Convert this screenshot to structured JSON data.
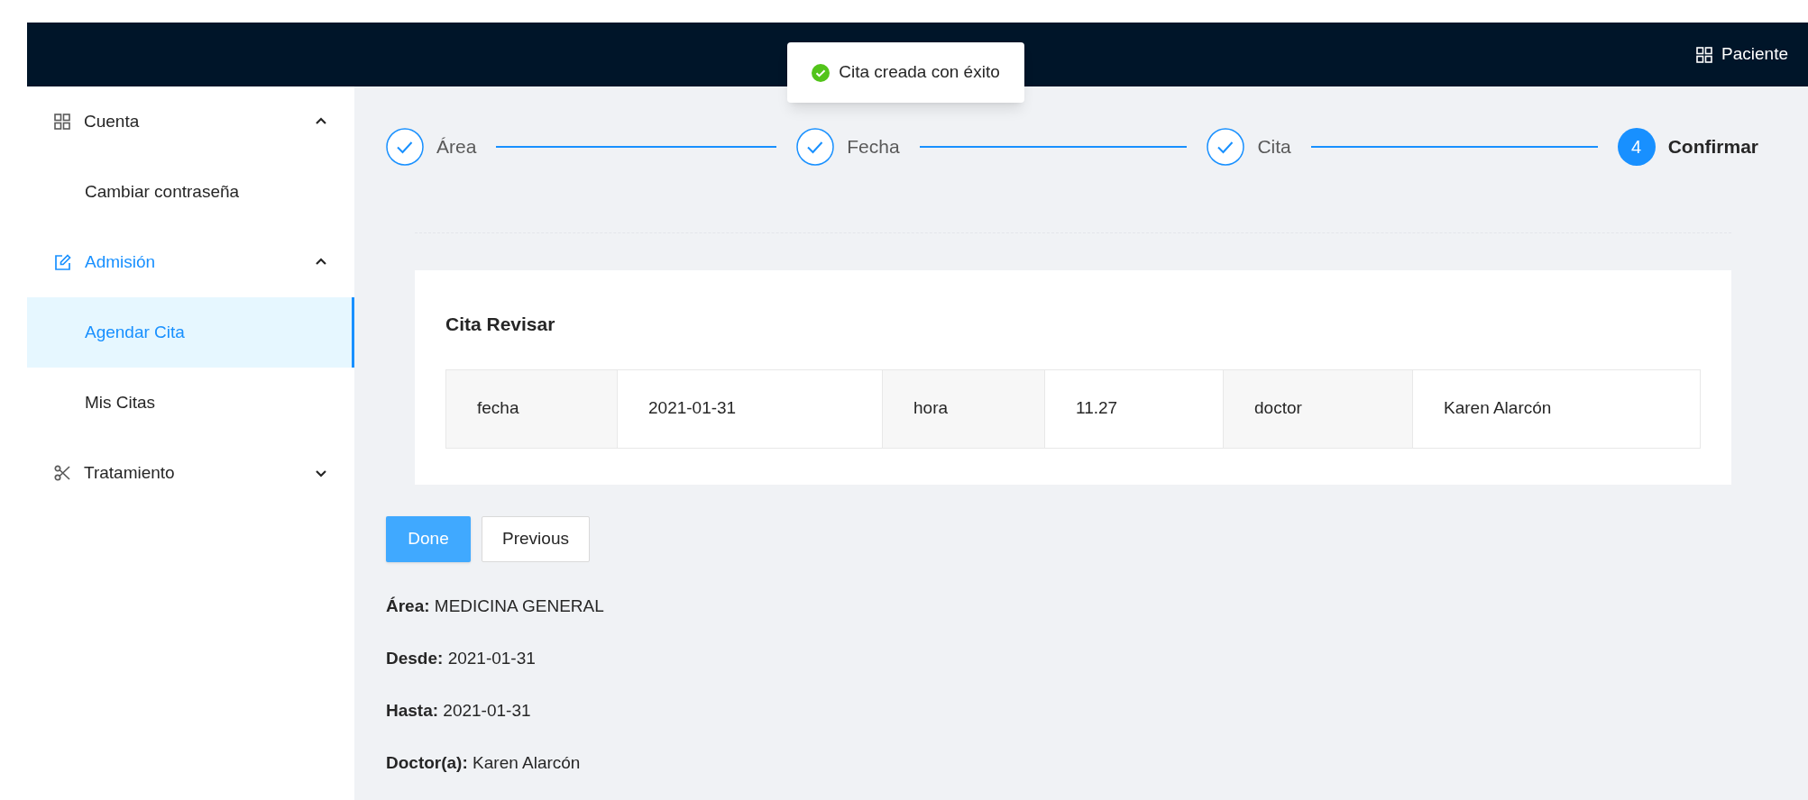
{
  "header": {
    "user_label": "Paciente"
  },
  "toast": {
    "text": "Cita creada con éxito"
  },
  "sidebar": {
    "items": [
      {
        "label": "Cuenta",
        "expanded": true,
        "active": false,
        "children": [
          {
            "label": "Cambiar contraseña",
            "selected": false
          }
        ]
      },
      {
        "label": "Admisión",
        "expanded": true,
        "active": true,
        "children": [
          {
            "label": "Agendar Cita",
            "selected": true
          },
          {
            "label": "Mis Citas",
            "selected": false
          }
        ]
      },
      {
        "label": "Tratamiento",
        "expanded": false,
        "active": false
      }
    ]
  },
  "steps": [
    {
      "label": "Área",
      "kind": "done"
    },
    {
      "label": "Fecha",
      "kind": "done"
    },
    {
      "label": "Cita",
      "kind": "done"
    },
    {
      "label": "Confirmar",
      "kind": "current",
      "number": "4"
    }
  ],
  "review": {
    "title": "Cita Revisar",
    "cells": [
      {
        "text": "fecha",
        "kind": "label"
      },
      {
        "text": "2021-01-31",
        "kind": "value"
      },
      {
        "text": "hora",
        "kind": "label"
      },
      {
        "text": "11.27",
        "kind": "value"
      },
      {
        "text": "doctor",
        "kind": "label"
      },
      {
        "text": "Karen Alarcón",
        "kind": "value"
      }
    ]
  },
  "buttons": [
    {
      "label": "Done",
      "kind": "primary"
    },
    {
      "label": "Previous",
      "kind": "default"
    }
  ],
  "summary": [
    "**Área:** MEDICINA GENERAL",
    "**Desde:** 2021-01-31",
    "**Hasta:** 2021-01-31",
    "**Doctor(a):** Karen Alarcón"
  ]
}
